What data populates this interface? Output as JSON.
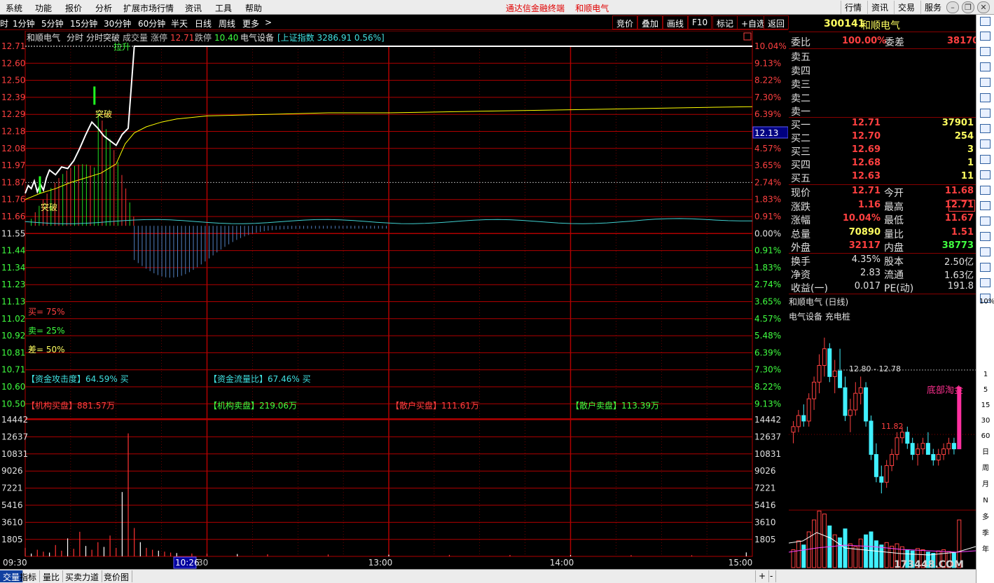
{
  "menu": {
    "items": [
      "系统",
      "功能",
      "报价",
      "分析",
      "扩展市场行情",
      "资讯",
      "工具",
      "帮助"
    ],
    "app_title": "通达信金融终端",
    "stock_title": "和顺电气",
    "right_tabs": [
      "行情",
      "资讯",
      "交易",
      "服务"
    ]
  },
  "period_bar": {
    "items": [
      "时",
      "1分钟",
      "5分钟",
      "15分钟",
      "30分钟",
      "60分钟",
      "半天",
      "日线",
      "周线",
      "更多"
    ],
    "more_arrow": ">",
    "ops": [
      "竞价",
      "叠加",
      "画线",
      "F10",
      "标记",
      "+自选",
      "返回"
    ]
  },
  "chart_header": {
    "name": "和顺电气",
    "mode1": "分时",
    "mode2": "分时突破",
    "label_volume": "成交量",
    "label_limit_up": "涨停",
    "limit_up": "12.71",
    "label_limit_down": "跌停",
    "limit_down": "10.40",
    "sector": "电气设备",
    "index_text": "[上证指数 3286.91 0.56%]"
  },
  "annotations": {
    "breakout1": "突破",
    "breakout2": "突破",
    "lift": "拉升",
    "buy": "买= 75%",
    "sell": "卖= 25%",
    "diff": "差= 50%",
    "attack": "【资金攻击度】64.59% 买",
    "flow": "【资金流量比】67.46% 买",
    "inst_buy": "【机构买盘】881.57万",
    "inst_sell": "【机构卖盘】219.06万",
    "retail_buy": "【散户买盘】111.61万",
    "retail_sell": "【散户卖盘】113.39万",
    "cursor_price": "12.13",
    "cursor_time": "10:26"
  },
  "axes": {
    "price_ticks": [
      "12.71",
      "12.60",
      "12.50",
      "12.39",
      "12.29",
      "12.18",
      "12.08",
      "11.97",
      "11.87",
      "11.76",
      "11.66",
      "11.55",
      "11.44",
      "11.34",
      "11.23",
      "11.13",
      "11.02",
      "10.92",
      "10.81",
      "10.71",
      "10.60",
      "10.50"
    ],
    "pct_ticks": [
      "10.04%",
      "9.13%",
      "8.22%",
      "7.30%",
      "6.39%",
      "5.48%",
      "4.57%",
      "3.65%",
      "2.74%",
      "1.83%",
      "0.91%",
      "0.00%",
      "0.91%",
      "1.83%",
      "2.74%",
      "3.65%",
      "4.57%",
      "5.48%",
      "6.39%",
      "7.30%",
      "8.22%",
      "9.13%"
    ],
    "vol_ticks": [
      "14442",
      "12637",
      "10831",
      "9026",
      "7221",
      "5416",
      "3610",
      "1805"
    ],
    "time_labels": [
      "09:30",
      "13:00",
      "14:00",
      "15:00"
    ],
    "time_partial": "30"
  },
  "chart_data": {
    "type": "line",
    "prev_close": 11.55,
    "limit_up": 12.71,
    "price_range": [
      10.4,
      12.71
    ],
    "price": {
      "x_minutes": [
        0,
        1,
        2,
        3,
        4,
        5,
        6,
        7,
        8,
        10,
        12,
        14,
        16,
        18,
        20,
        22,
        24,
        26,
        28,
        30,
        32,
        34,
        36,
        38,
        40,
        42,
        44,
        46,
        48,
        50,
        52,
        54,
        56,
        58,
        60,
        90,
        120,
        150,
        180,
        210,
        240
      ],
      "y": [
        11.76,
        11.81,
        11.79,
        11.84,
        11.77,
        11.82,
        11.78,
        11.86,
        11.91,
        11.88,
        11.93,
        11.92,
        11.97,
        12.05,
        12.14,
        12.22,
        12.18,
        12.13,
        12.1,
        12.07,
        12.14,
        12.18,
        12.71,
        12.71,
        12.71,
        12.71,
        12.71,
        12.71,
        12.71,
        12.71,
        12.71,
        12.71,
        12.71,
        12.71,
        12.71,
        12.71,
        12.71,
        12.71,
        12.71,
        12.71,
        12.71
      ]
    },
    "avg_price": {
      "x_minutes": [
        0,
        5,
        10,
        15,
        20,
        25,
        30,
        33,
        36,
        40,
        45,
        50,
        60,
        80,
        100,
        120,
        150,
        180,
        210,
        240
      ],
      "y": [
        11.72,
        11.76,
        11.79,
        11.83,
        11.86,
        11.89,
        11.95,
        12.08,
        12.15,
        12.19,
        12.22,
        12.24,
        12.26,
        12.27,
        12.28,
        12.28,
        12.29,
        12.3,
        12.31,
        12.32
      ]
    },
    "volume": {
      "x_minutes": [
        0,
        2,
        4,
        6,
        8,
        10,
        12,
        14,
        16,
        18,
        20,
        22,
        24,
        26,
        28,
        30,
        32,
        34,
        36,
        38,
        40,
        42,
        44,
        46,
        48,
        50,
        55,
        60,
        70,
        80,
        100,
        120,
        140,
        160,
        180,
        200,
        220,
        238
      ],
      "values": [
        900,
        300,
        700,
        500,
        400,
        1200,
        600,
        1900,
        800,
        2600,
        1100,
        700,
        1500,
        1000,
        2200,
        900,
        6800,
        13000,
        3000,
        1500,
        900,
        700,
        600,
        500,
        400,
        350,
        300,
        280,
        250,
        220,
        200,
        180,
        160,
        150,
        140,
        130,
        120,
        420
      ]
    }
  },
  "quote": {
    "code": "300141",
    "name": "和顺电气",
    "wb_label": "委比",
    "wb_value": "100.00%",
    "wc_label": "委差",
    "wc_value": "38170",
    "asks": [
      {
        "label": "卖五",
        "price": "",
        "vol": ""
      },
      {
        "label": "卖四",
        "price": "",
        "vol": ""
      },
      {
        "label": "卖三",
        "price": "",
        "vol": ""
      },
      {
        "label": "卖二",
        "price": "",
        "vol": ""
      },
      {
        "label": "卖一",
        "price": "",
        "vol": ""
      }
    ],
    "bids": [
      {
        "label": "买一",
        "price": "12.71",
        "vol": "37901"
      },
      {
        "label": "买二",
        "price": "12.70",
        "vol": "254"
      },
      {
        "label": "买三",
        "price": "12.69",
        "vol": "3"
      },
      {
        "label": "买四",
        "price": "12.68",
        "vol": "1"
      },
      {
        "label": "买五",
        "price": "12.63",
        "vol": "11"
      }
    ],
    "stats": [
      {
        "l1": "现价",
        "v1": "12.71",
        "l2": "今开",
        "v2": "11.68"
      },
      {
        "l1": "涨跌",
        "v1": "1.16",
        "l2": "最高",
        "v2": "12.71"
      },
      {
        "l1": "涨幅",
        "v1": "10.04%",
        "l2": "最低",
        "v2": "11.67"
      },
      {
        "l1": "总量",
        "v1": "70890",
        "l2": "量比",
        "v2": "1.51"
      },
      {
        "l1": "外盘",
        "v1": "32117",
        "l2": "内盘",
        "v2": "38773"
      }
    ],
    "stats2": [
      {
        "l1": "换手",
        "v1": "4.35%",
        "l2": "股本",
        "v2": "2.50亿"
      },
      {
        "l1": "净资",
        "v1": "2.83",
        "l2": "流通",
        "v2": "1.63亿"
      },
      {
        "l1": "收益(一)",
        "v1": "0.017",
        "l2": "PE(动)",
        "v2": "191.8"
      }
    ]
  },
  "daily": {
    "title": "和顺电气 (日线)",
    "tags": "电气设备 充电桩",
    "range_label": "12.80 - 12.78",
    "low_label": "11.82",
    "signal": "底部淘金",
    "watermark": "173448.COM",
    "candles": [
      [
        11.9,
        12.1,
        11.7,
        12.0
      ],
      [
        12.0,
        12.3,
        11.9,
        12.2
      ],
      [
        12.2,
        12.4,
        12.0,
        12.1
      ],
      [
        12.1,
        12.6,
        12.0,
        12.5
      ],
      [
        12.5,
        12.9,
        12.3,
        12.8
      ],
      [
        12.8,
        13.3,
        12.6,
        13.1
      ],
      [
        13.1,
        13.6,
        12.9,
        13.4
      ],
      [
        13.4,
        13.5,
        12.8,
        12.9
      ],
      [
        12.9,
        13.2,
        12.6,
        13.0
      ],
      [
        13.0,
        13.4,
        12.8,
        12.7
      ],
      [
        12.7,
        12.9,
        12.1,
        12.2
      ],
      [
        12.2,
        12.5,
        11.9,
        12.3
      ],
      [
        12.3,
        12.8,
        12.2,
        12.6
      ],
      [
        12.6,
        12.9,
        12.4,
        12.7
      ],
      [
        12.7,
        12.8,
        12.0,
        12.1
      ],
      [
        12.1,
        12.2,
        11.4,
        11.5
      ],
      [
        11.5,
        11.7,
        11.0,
        11.1
      ],
      [
        11.1,
        11.3,
        10.8,
        11.0
      ],
      [
        11.0,
        11.4,
        10.9,
        11.3
      ],
      [
        11.3,
        11.6,
        11.2,
        11.5
      ],
      [
        11.5,
        11.9,
        11.4,
        11.8
      ],
      [
        11.8,
        12.0,
        11.7,
        11.9
      ],
      [
        11.9,
        12.0,
        11.6,
        11.7
      ],
      [
        11.7,
        11.8,
        11.4,
        11.5
      ],
      [
        11.5,
        11.7,
        11.3,
        11.6
      ],
      [
        11.6,
        11.8,
        11.5,
        11.7
      ],
      [
        11.7,
        11.9,
        11.6,
        11.5
      ],
      [
        11.5,
        11.6,
        11.3,
        11.4
      ],
      [
        11.4,
        11.6,
        11.3,
        11.5
      ],
      [
        11.5,
        11.7,
        11.4,
        11.6
      ],
      [
        11.6,
        11.8,
        11.5,
        11.7
      ],
      [
        11.7,
        11.8,
        11.5,
        11.6
      ],
      [
        11.6,
        12.71,
        11.6,
        12.71
      ]
    ],
    "volumes": [
      30,
      45,
      38,
      60,
      80,
      95,
      90,
      70,
      55,
      50,
      65,
      40,
      35,
      48,
      55,
      60,
      45,
      38,
      42,
      36,
      40,
      35,
      30,
      28,
      32,
      30,
      26,
      24,
      28,
      30,
      27,
      25,
      80
    ]
  },
  "right_toolbar": {
    "labels": [
      "10%",
      "1",
      "5",
      "15",
      "30",
      "60",
      "日",
      "周",
      "月",
      "N",
      "多",
      "季",
      "年"
    ]
  },
  "bottom_tabs": [
    "交量",
    "指标",
    "量比",
    "买卖力道",
    "竞价图"
  ],
  "bottom_right": [
    "+",
    "-"
  ],
  "colors": {
    "up": "#ff3232",
    "down": "#00e4ff",
    "avg": "#ffff00",
    "grid": "#b00000",
    "price_line": "#ffffff"
  }
}
